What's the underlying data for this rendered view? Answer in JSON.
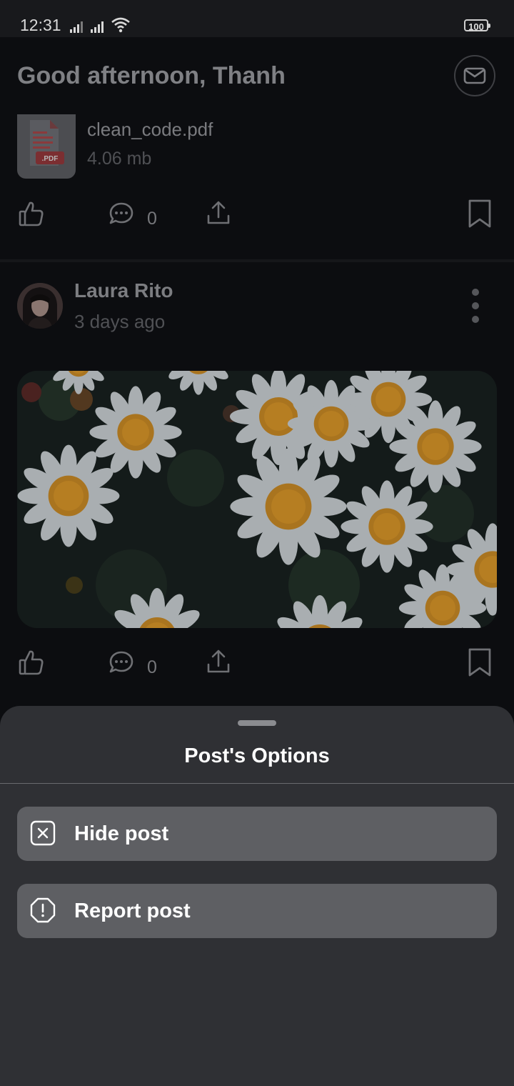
{
  "status_bar": {
    "time": "12:31",
    "battery": "100"
  },
  "header": {
    "greeting": "Good afternoon, Thanh"
  },
  "file_post": {
    "file_badge": ".PDF",
    "file_name": "clean_code.pdf",
    "file_size": "4.06 mb",
    "comment_count": "0"
  },
  "photo_post": {
    "author": "Laura Rito",
    "time_ago": "3 days ago",
    "comment_count": "0"
  },
  "sheet": {
    "title": "Post's Options",
    "options": [
      {
        "label": "Hide post",
        "icon": "close-square-icon"
      },
      {
        "label": "Report post",
        "icon": "alert-octagon-icon"
      }
    ]
  },
  "colors": {
    "background": "#0c0d10",
    "sheet": "#2f3034",
    "option": "#5e5f63",
    "pdf_red": "#e53935"
  }
}
